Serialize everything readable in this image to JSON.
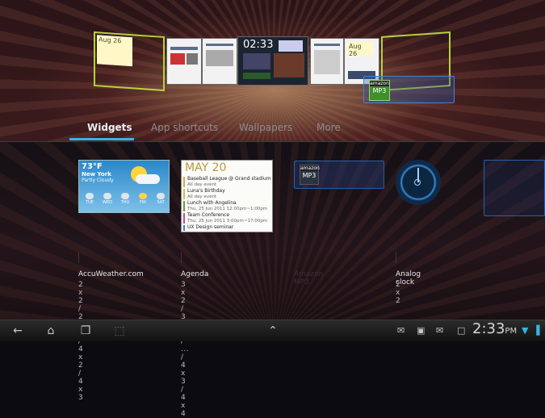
{
  "home_screens": {
    "sticky_note": "Aug 26",
    "sticky_note_right": "Aug 26",
    "thumb_clock": "02:33",
    "mp3_icon_brand": "amazon",
    "mp3_icon_label": "MP3"
  },
  "tabs": [
    {
      "label": "Widgets",
      "active": true
    },
    {
      "label": "App shortcuts",
      "active": false
    },
    {
      "label": "Wallpapers",
      "active": false
    },
    {
      "label": "More",
      "active": false
    }
  ],
  "widgets": {
    "accuweather": {
      "name": "AccuWeather.com",
      "sizes": "2 x 2 / 2 x 3 / 4 x 2 / 4 x 3",
      "temp": "73°F",
      "city": "New York",
      "condition": "Partly Cloudy",
      "days": [
        "TUE",
        "WED",
        "THU",
        "FRI",
        "SAT"
      ]
    },
    "agenda": {
      "name": "Agenda",
      "sizes": "3 x 2 / 3 x 3 / ... / 4 x 3 / 4 x 4",
      "date": "MAY 20",
      "events": [
        {
          "title": "Baseball League @ Grand stadium",
          "meta": "All day event"
        },
        {
          "title": "Luna's Birthday",
          "meta": "All day event"
        },
        {
          "title": "Lunch with Angelina",
          "meta": "Thu, 25 Jun 2011 12:00pm~1:00pm"
        },
        {
          "title": "Team Conference",
          "meta": "Thu, 25 Jun 2011 3:00pm~17:00pm"
        },
        {
          "title": "UX Design seminar",
          "meta": ""
        }
      ]
    },
    "amazon_mp3": {
      "name": "Amazon MP3",
      "brand": "amazon",
      "label": "MP3"
    },
    "analog_clock": {
      "name": "Analog clock",
      "sizes": "2 x 2"
    }
  },
  "status_bar": {
    "time": "2:33",
    "ampm": "PM"
  },
  "colors": {
    "accent": "#33b5e5",
    "outline_green": "#b6d23b",
    "agenda_date": "#b49a3c"
  },
  "icons": [
    "back-icon",
    "home-icon",
    "recent-apps-icon",
    "screenshot-icon",
    "chevron-up-icon",
    "gmail-icon",
    "briefcase-icon",
    "email-icon",
    "calendar-icon",
    "wifi-icon",
    "battery-icon"
  ]
}
